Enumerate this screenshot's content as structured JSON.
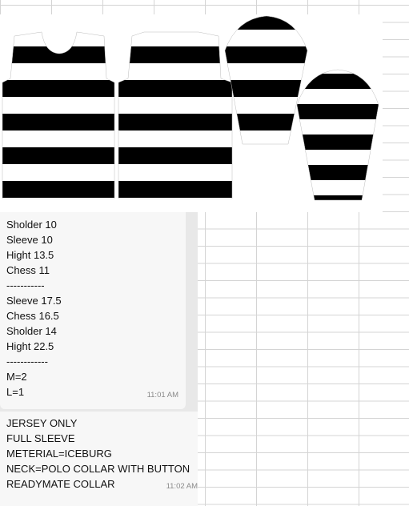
{
  "chat": {
    "message1": {
      "lines": [
        "Sholder 10",
        "Sleeve 10",
        "Hight 13.5",
        "Chess 11",
        "-----------",
        "Sleeve 17.5",
        "Chess 16.5",
        "Sholder 14",
        "Hight 22.5",
        "------------",
        "M=2",
        "L=1"
      ],
      "time": "11:01 AM"
    },
    "message2": {
      "lines": [
        "JERSEY ONLY",
        "FULL SLEEVE",
        "METERIAL=ICEBURG",
        "NECK=POLO COLLAR WITH BUTTON",
        "READYMATE COLLAR"
      ],
      "time": "11:02 AM"
    }
  },
  "image": {
    "description_icon": "striped-jersey-pattern-image",
    "stripe_colors": [
      "#000000",
      "#ffffff"
    ]
  }
}
